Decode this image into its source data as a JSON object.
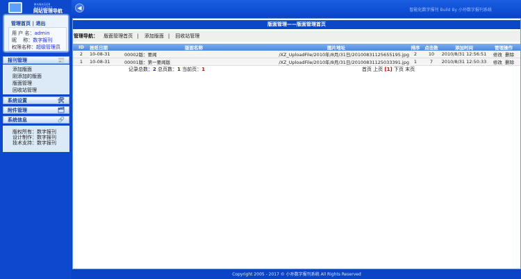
{
  "header": {
    "brand": "智能化数字报刊  Build By  小孙数字报刊系统"
  },
  "sidebar": {
    "logo_en": "MANAGER NAVIGATES",
    "logo_cn": "网站管理导航",
    "home": "管理首页",
    "sep": "|",
    "logout": "退出",
    "user": {
      "name_label": "用 户 名：",
      "name": "admin",
      "nick_label": "昵　 称：",
      "nick": "数字报刊",
      "role_label": "权限名称：",
      "role": "超级管理员"
    },
    "sections": [
      {
        "label": "报刊管理"
      },
      {
        "label": "系统设置"
      },
      {
        "label": "附件管理"
      },
      {
        "label": "系统信息"
      }
    ],
    "items": [
      "添加版面",
      "刚添加的版面",
      "版面管理",
      "回收站管理"
    ],
    "info": [
      {
        "k": "版权所有：",
        "v": "数字报刊"
      },
      {
        "k": "设计制作：",
        "v": "数字报刊"
      },
      {
        "k": "技术支持：",
        "v": "数字报刊"
      }
    ]
  },
  "main": {
    "title": "版面管理——版面管理首页",
    "nav_label": "管理导航：",
    "nav": [
      "版面管理首页",
      "添加版面",
      "回收站管理"
    ],
    "columns": [
      "ID",
      "报纸日期",
      "版面名称",
      "图片地址",
      "排序",
      "点击数",
      "添加时间",
      "管理操作"
    ],
    "rows": [
      {
        "id": "2",
        "date": "10-08-31",
        "name": "00002版：要闻",
        "img": "/XZ_UploadFile/2010年/8月/31日/20100831125655195.jpg",
        "sort": "2",
        "clicks": "10",
        "time": "2010/8/31 12:56:51",
        "edit": "修改",
        "del": "删除"
      },
      {
        "id": "1",
        "date": "10-08-31",
        "name": "00001版：第一要闻版",
        "img": "/XZ_UploadFile/2010年/8月/31日/20100831125033391.jpg",
        "sort": "1",
        "clicks": "7",
        "time": "2010/8/31 12:50:33",
        "edit": "修改",
        "del": "删除"
      }
    ],
    "pager": {
      "total_label": "记录总数：",
      "total": "2",
      "pages_label": "总页数：",
      "pages": "1",
      "cur_label": "当前页：",
      "cur": "1",
      "first": "首页",
      "prev": "上页",
      "page": "[1]",
      "next": "下页",
      "last": "末页"
    }
  },
  "footer": "Copyright 2005 - 2017 © 小孙数字报刊系统 All Rights Reserved"
}
